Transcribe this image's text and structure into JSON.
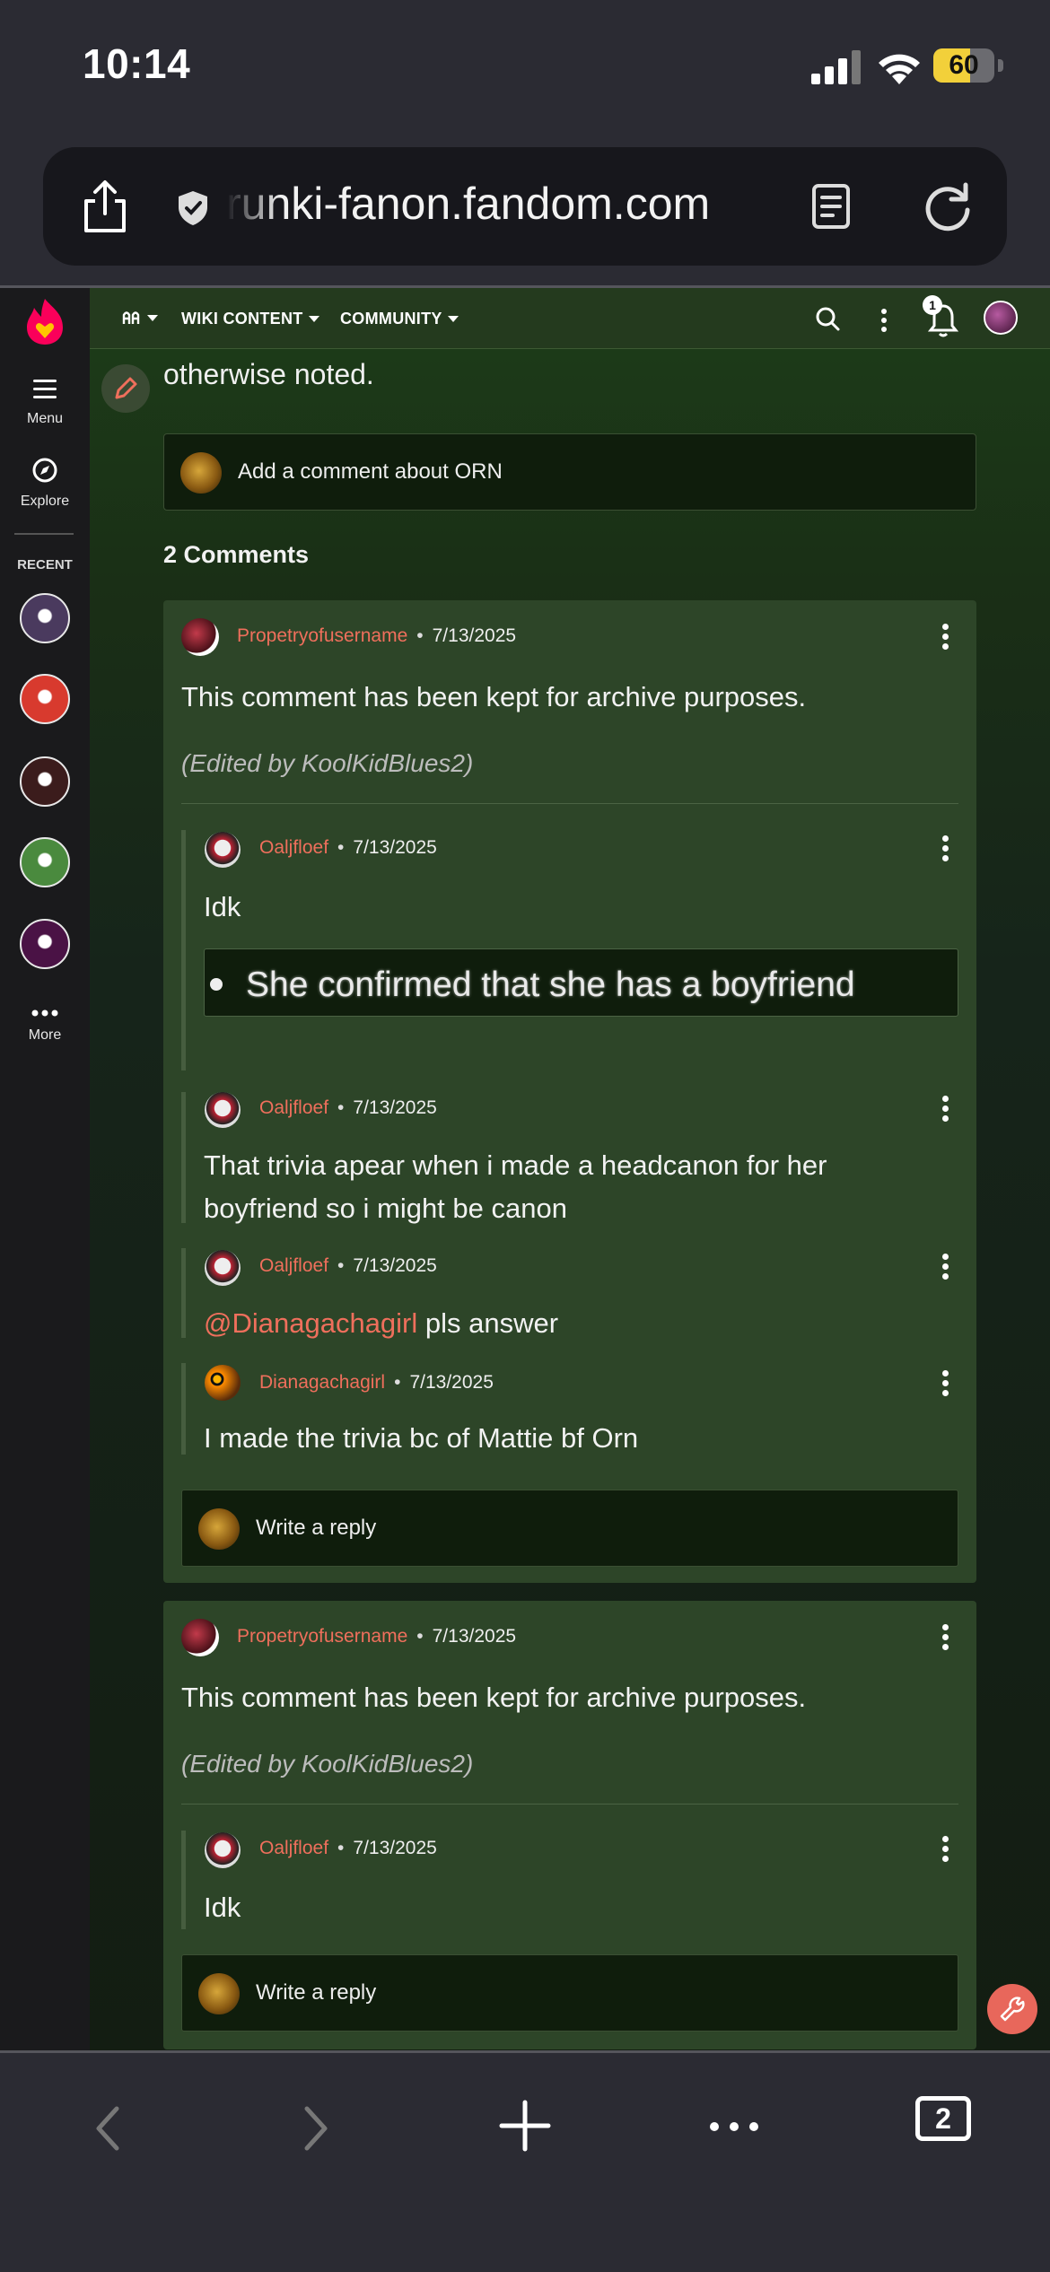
{
  "status_bar": {
    "time": "10:14",
    "battery_level": "60",
    "battery_fraction": 0.6
  },
  "url_bar": {
    "url": "runki-fanon.fandom.com",
    "icons": [
      "share-icon",
      "shield-icon",
      "reader-icon",
      "reload-icon"
    ]
  },
  "left_rail": {
    "menu_label": "Menu",
    "explore_label": "Explore",
    "recent_label": "RECENT",
    "more_label": "More",
    "recent_avatars": [
      {
        "color": "#4a3a5e"
      },
      {
        "color": "#d83a2e"
      },
      {
        "color": "#3b1c1c"
      },
      {
        "color": "#4a8a3e"
      },
      {
        "color": "#4a1245"
      }
    ]
  },
  "community_header": {
    "nav": [
      {
        "label": "WIKI CONTENT"
      },
      {
        "label": "COMMUNITY"
      }
    ],
    "notification_count": "1"
  },
  "page": {
    "top_text": "otherwise noted.",
    "add_comment_placeholder": "Add a comment about ORN",
    "comments_count": "2 Comments"
  },
  "comments": [
    {
      "user": "Propetryofusername",
      "date": "7/13/2025",
      "body": "This comment has been kept for archive purposes.",
      "edited": "(Edited by KoolKidBlues2)",
      "replies": [
        {
          "user": "Oaljfloef",
          "date": "7/13/2025",
          "body": "Idk",
          "quote": "She confirmed that she has a boyfriend"
        },
        {
          "user": "Oaljfloef",
          "date": "7/13/2025",
          "body_line1": "That trivia apear when i made a headcanon for her",
          "body_line2": "boyfriend so i might be canon"
        },
        {
          "user": "Oaljfloef",
          "date": "7/13/2025",
          "mention": "@Dianagachagirl",
          "body": "pls answer"
        },
        {
          "user": "Dianagachagirl",
          "date": "7/13/2025",
          "body": "I made the trivia bc of Mattie bf Orn"
        }
      ],
      "reply_placeholder": "Write a reply"
    },
    {
      "user": "Propetryofusername",
      "date": "7/13/2025",
      "body": "This comment has been kept for archive purposes.",
      "edited": "(Edited by KoolKidBlues2)",
      "replies": [
        {
          "user": "Oaljfloef",
          "date": "7/13/2025",
          "body": "Idk"
        }
      ],
      "reply_placeholder": "Write a reply"
    }
  ],
  "toolbar": {
    "tab_count": "2"
  },
  "colors": {
    "accent_username": "#ef6f5c",
    "card_bg": "#2d4528",
    "header_bg": "#243a1e"
  }
}
